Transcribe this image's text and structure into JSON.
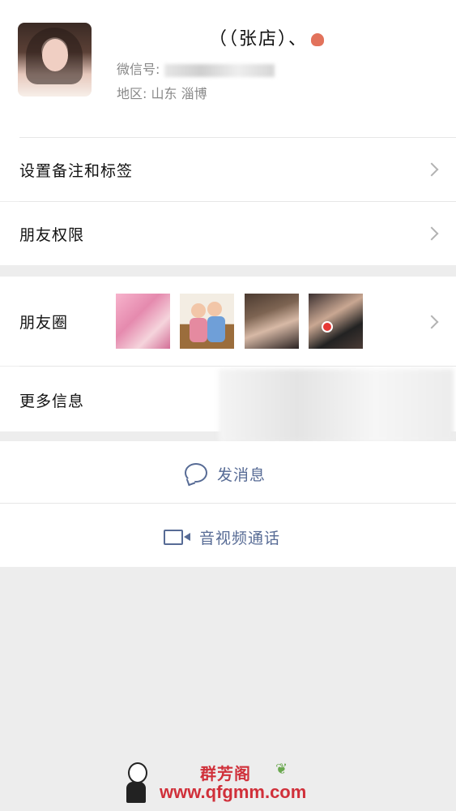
{
  "profile": {
    "name": "（（张店）、",
    "wechat_label": "微信号:",
    "region_label": "地区:",
    "region_value": "山东  淄博"
  },
  "menu": {
    "remark_label": "设置备注和标签",
    "permission_label": "朋友权限",
    "moments_label": "朋友圈",
    "more_info_label": "更多信息"
  },
  "actions": {
    "message_label": "发消息",
    "call_label": "音视频通话"
  },
  "watermark": {
    "title": "群芳阁",
    "url": "www.qfgmm.com"
  },
  "colors": {
    "link": "#576b95",
    "watermark": "#d0303a",
    "background": "#ededed"
  }
}
